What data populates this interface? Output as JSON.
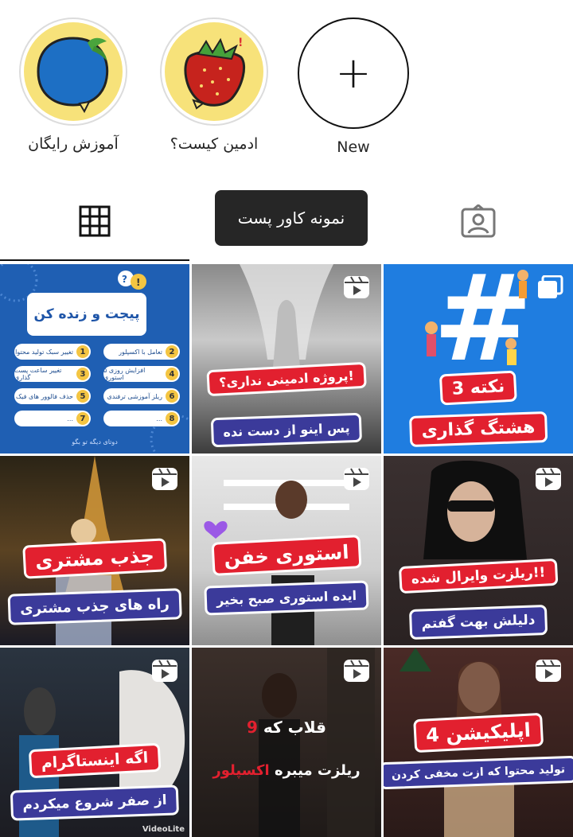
{
  "highlights": [
    {
      "label": "آموزش رایگان"
    },
    {
      "label": "ادمین کیست؟"
    },
    {
      "label": "New"
    }
  ],
  "tooltip": "نمونه کاور پست",
  "posts": [
    {
      "header": "پیجت و زنده کن",
      "items": [
        "تعامل با اکسپلور",
        "تغییر سبک تولید محتوا",
        "افزایش روزی ۵ استوری",
        "تغییر ساعت پست گذاری",
        "ریلز آموزشی ترفندی",
        "حذف فالوور های فیک",
        "...",
        "..."
      ],
      "numbers": [
        "2",
        "1",
        "4",
        "3",
        "6",
        "5",
        "8",
        "7"
      ],
      "footer": "دوتای دیگه تو بگو"
    },
    {
      "title": "پروژه ادمینی نداری؟!",
      "subtitle": "پس اینو از دست نده"
    },
    {
      "title": "3 نکته",
      "subtitle": "هشتگ گذاری"
    },
    {
      "title": "جذب مشتری",
      "subtitle": "راه های جذب مشتری"
    },
    {
      "title": "استوری خفن",
      "subtitle": "ایده استوری صبح بخیر"
    },
    {
      "title": "ریلزت وایرال شده!!",
      "subtitle": "دلیلش بهت گفتم"
    },
    {
      "title": "اگه اینستاگرام",
      "subtitle": "از صفر شروع میکردم",
      "watermark": "VideoLite"
    },
    {
      "line1_num": "9",
      "line1": "قلاب که",
      "line2": "ریلزت میبره",
      "line2_accent": "اکسپلور"
    },
    {
      "title": "4 اپلیکیشن",
      "subtitle": "تولید محتوا که ازت مخفی کردن"
    }
  ],
  "colors": {
    "accent_red": "#e2202f",
    "accent_blue": "#3b3a9a",
    "tooltip_bg": "#262626"
  }
}
